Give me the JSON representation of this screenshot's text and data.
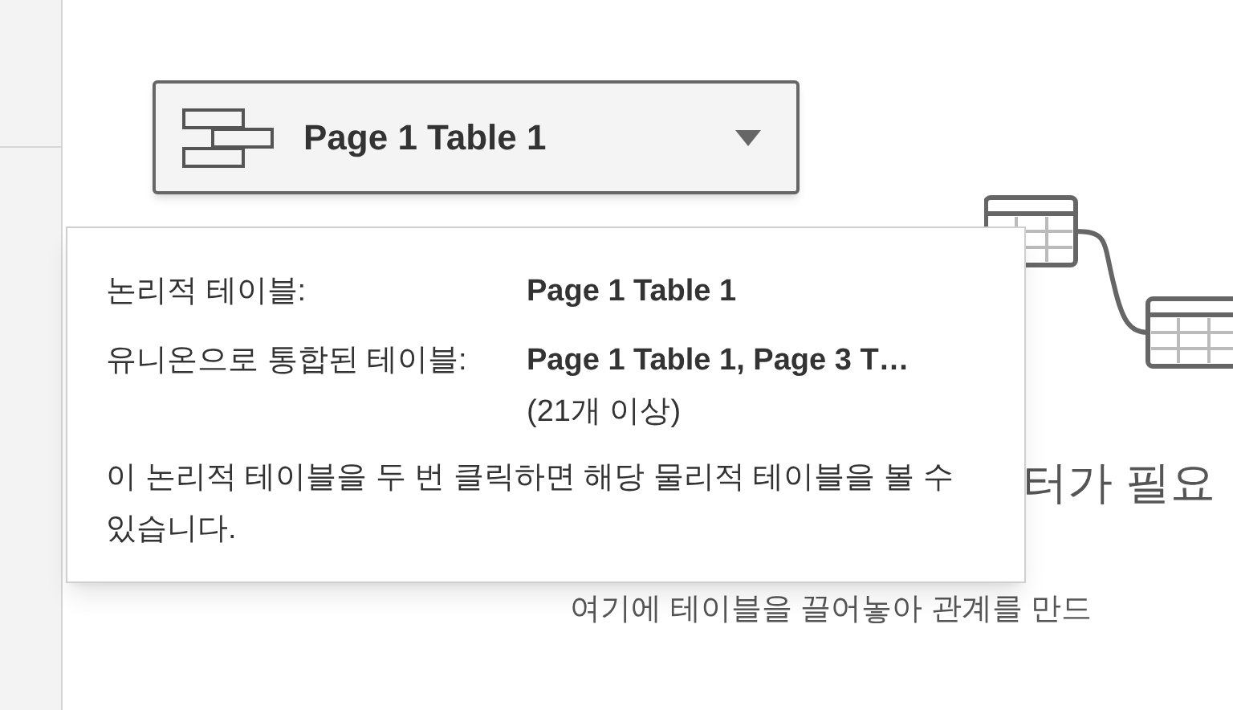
{
  "table_selector": {
    "label": "Page 1 Table 1"
  },
  "tooltip": {
    "rows": [
      {
        "label": "논리적 테이블:",
        "value": "Page 1 Table 1"
      },
      {
        "label": "유니온으로 통합된 테이블:",
        "value": "Page 1 Table 1, Page 3 T…",
        "note": "(21개 이상)"
      }
    ],
    "description": "이 논리적 테이블을 두 번 클릭하면 해당 물리적 테이블을 볼 수 있습니다."
  },
  "canvas": {
    "heading": "터가 필요",
    "hint": "여기에 테이블을 끌어놓아 관계를 만드"
  }
}
